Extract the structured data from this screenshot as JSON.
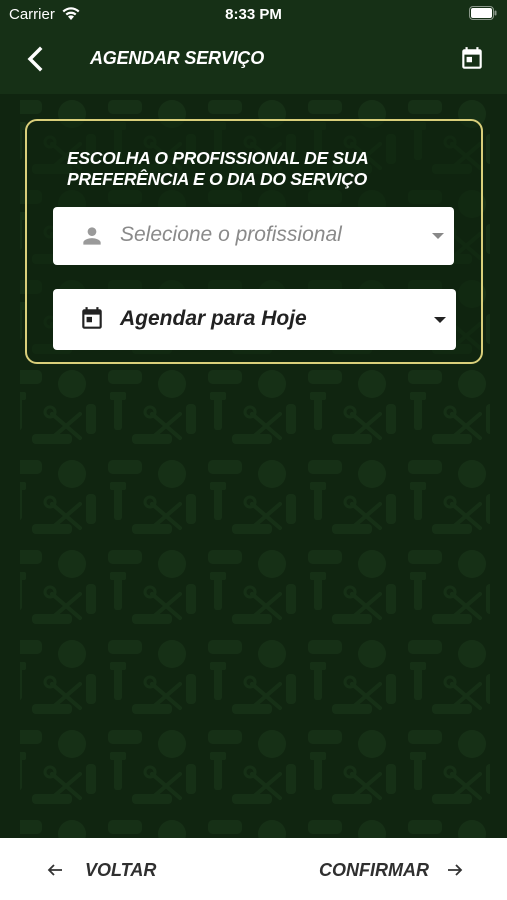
{
  "status_bar": {
    "carrier": "Carrier",
    "time": "8:33 PM"
  },
  "header": {
    "title": "AGENDAR SERVIÇO",
    "back_icon": "chevron-left-icon",
    "action_icon": "calendar-icon"
  },
  "card": {
    "title": "ESCOLHA O PROFISSIONAL DE SUA PREFERÊNCIA E O DIA DO SERVIÇO",
    "border_color": "#d9cf7a",
    "professional_select": {
      "placeholder": "Selecione o profissional",
      "icon": "person-icon"
    },
    "date_select": {
      "value": "Agendar para Hoje",
      "icon": "calendar-icon"
    }
  },
  "bottom_bar": {
    "back_label": "VOLTAR",
    "confirm_label": "CONFIRMAR"
  },
  "colors": {
    "background": "#102510",
    "header": "#163016",
    "accent": "#d9cf7a"
  }
}
